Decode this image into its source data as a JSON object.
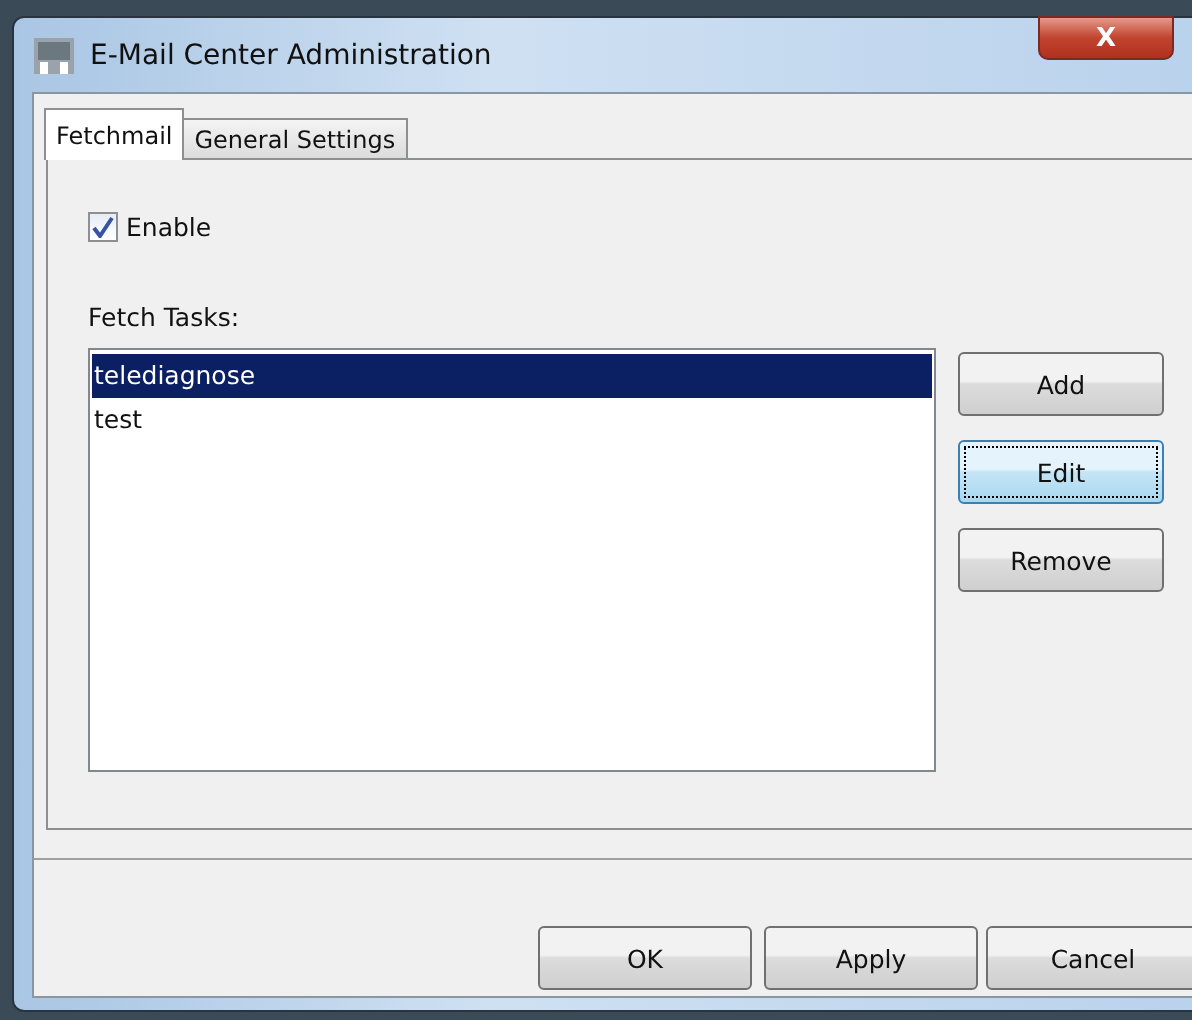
{
  "window": {
    "title": "E-Mail Center Administration",
    "close_label": "X"
  },
  "tabs": [
    {
      "label": "Fetchmail",
      "selected": true
    },
    {
      "label": "General Settings",
      "selected": false
    }
  ],
  "enable": {
    "label": "Enable",
    "checked": true
  },
  "fetch_tasks": {
    "label": "Fetch Tasks:",
    "items": [
      {
        "label": "telediagnose",
        "selected": true
      },
      {
        "label": "test",
        "selected": false
      }
    ]
  },
  "side_buttons": [
    {
      "label": "Add",
      "focused": false
    },
    {
      "label": "Edit",
      "focused": true
    },
    {
      "label": "Remove",
      "focused": false
    }
  ],
  "dialog_buttons": [
    {
      "label": "OK"
    },
    {
      "label": "Apply"
    },
    {
      "label": "Cancel"
    }
  ]
}
